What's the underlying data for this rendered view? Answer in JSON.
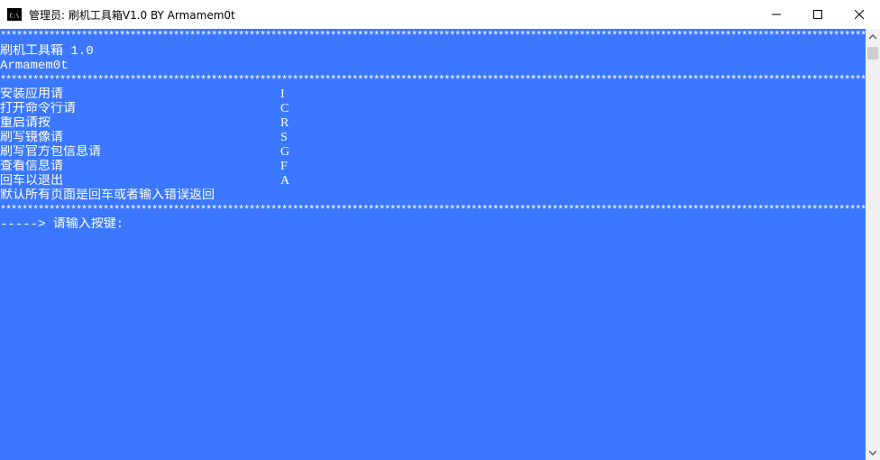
{
  "window": {
    "title": "管理员:  刷机工具箱V1.0 BY Armamem0t",
    "icon": "console-app-icon"
  },
  "console": {
    "separator": "*************************************************************************************************************************************************************************************",
    "header_title": "刷机工具箱 1.0",
    "header_author": "Armamem0t",
    "menu": [
      {
        "label": "安装应用请",
        "key": "I"
      },
      {
        "label": "打开命令行请",
        "key": "C"
      },
      {
        "label": "重启请按",
        "key": "R"
      },
      {
        "label": "刷写镜像请",
        "key": "S"
      },
      {
        "label": "刷写官方包信息请",
        "key": "G"
      },
      {
        "label": "查看信息请",
        "key": "F"
      },
      {
        "label": "回车以退出",
        "key": "A"
      }
    ],
    "default_note": "默认所有页面是回车或者输入错误返回",
    "prompt": "-----> 请输入按键:"
  },
  "colors": {
    "console_bg": "#3b78ff",
    "console_fg": "#ffffff"
  }
}
